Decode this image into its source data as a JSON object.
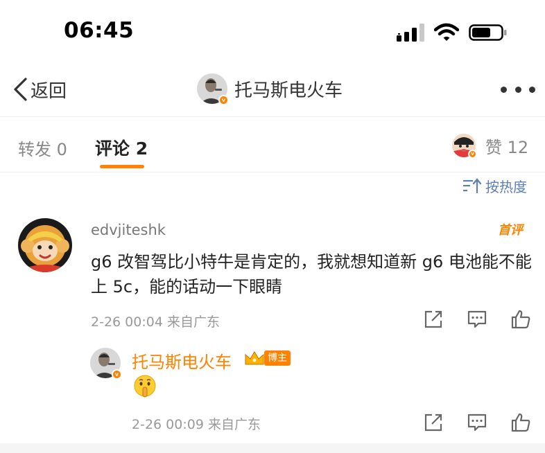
{
  "status_bar": {
    "time": "06:45"
  },
  "nav": {
    "back_label": "返回",
    "title": "托马斯电火车"
  },
  "tabs": {
    "forward_label": "转发",
    "forward_count": "0",
    "comments_label": "评论",
    "comments_count": "2",
    "likes_label": "赞",
    "likes_count": "12"
  },
  "sort": {
    "label": "按热度"
  },
  "comments": [
    {
      "username": "edvjiteshk",
      "badge": "首评",
      "text": "g6 改智驾比小特牛是肯定的，我就想知道新 g6 电池能不能上 5c，能的话动一下眼睛",
      "time": "2-26 00:04",
      "location": "来自广东",
      "replies": [
        {
          "username": "托马斯电火车",
          "tag": "博主",
          "emoji_icon": "shushing-face-icon",
          "time": "2-26 00:09",
          "location": "来自广东"
        }
      ]
    }
  ],
  "colors": {
    "accent": "#ff8200",
    "link": "#5c7fb8",
    "muted": "#999999"
  }
}
